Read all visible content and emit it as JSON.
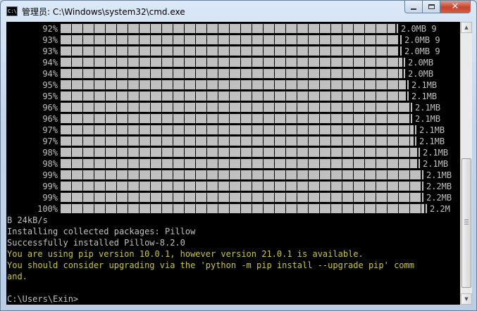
{
  "window": {
    "title": "管理员: C:\\Windows\\system32\\cmd.exe",
    "icon": "cmd-icon",
    "icon_text": "C:\\"
  },
  "progress_rows": [
    {
      "percent": "92%",
      "progress": 0.92,
      "size": "2.0MB 9"
    },
    {
      "percent": "93%",
      "progress": 0.93,
      "size": "2.0MB 9"
    },
    {
      "percent": "93%",
      "progress": 0.93,
      "size": "2.0MB 9"
    },
    {
      "percent": "94%",
      "progress": 0.94,
      "size": "2.0MB"
    },
    {
      "percent": "94%",
      "progress": 0.94,
      "size": "2.0MB"
    },
    {
      "percent": "95%",
      "progress": 0.95,
      "size": "2.1MB"
    },
    {
      "percent": "95%",
      "progress": 0.95,
      "size": "2.1MB"
    },
    {
      "percent": "96%",
      "progress": 0.96,
      "size": "2.1MB"
    },
    {
      "percent": "96%",
      "progress": 0.96,
      "size": "2.1MB"
    },
    {
      "percent": "97%",
      "progress": 0.97,
      "size": "2.1MB"
    },
    {
      "percent": "97%",
      "progress": 0.97,
      "size": "2.1MB"
    },
    {
      "percent": "98%",
      "progress": 0.98,
      "size": "2.1MB"
    },
    {
      "percent": "98%",
      "progress": 0.98,
      "size": "2.1MB"
    },
    {
      "percent": "99%",
      "progress": 0.99,
      "size": "2.1MB"
    },
    {
      "percent": "99%",
      "progress": 0.99,
      "size": "2.2MB"
    },
    {
      "percent": "99%",
      "progress": 0.99,
      "size": "2.2MB"
    },
    {
      "percent": "100%",
      "progress": 1.0,
      "size": "2.2M"
    }
  ],
  "output_lines": [
    {
      "text": "B 24kB/s",
      "color": "#c0c0c0"
    },
    {
      "text": "Installing collected packages: Pillow",
      "color": "#c0c0c0"
    },
    {
      "text": "Successfully installed Pillow-8.2.0",
      "color": "#c0c0c0"
    },
    {
      "text": "You are using pip version 10.0.1, however version 21.0.1 is available.",
      "color": "#c7c73f"
    },
    {
      "text": "You should consider upgrading via the 'python -m pip install --upgrade pip' comm",
      "color": "#c7c73f"
    },
    {
      "text": "and.",
      "color": "#c7c73f"
    },
    {
      "text": "",
      "color": "#c0c0c0"
    },
    {
      "text": "C:\\Users\\Exin>",
      "color": "#c0c0c0"
    }
  ],
  "colors": {
    "console_bg": "#000000",
    "console_text": "#c0c0c0",
    "warning_text": "#c7c73f"
  }
}
